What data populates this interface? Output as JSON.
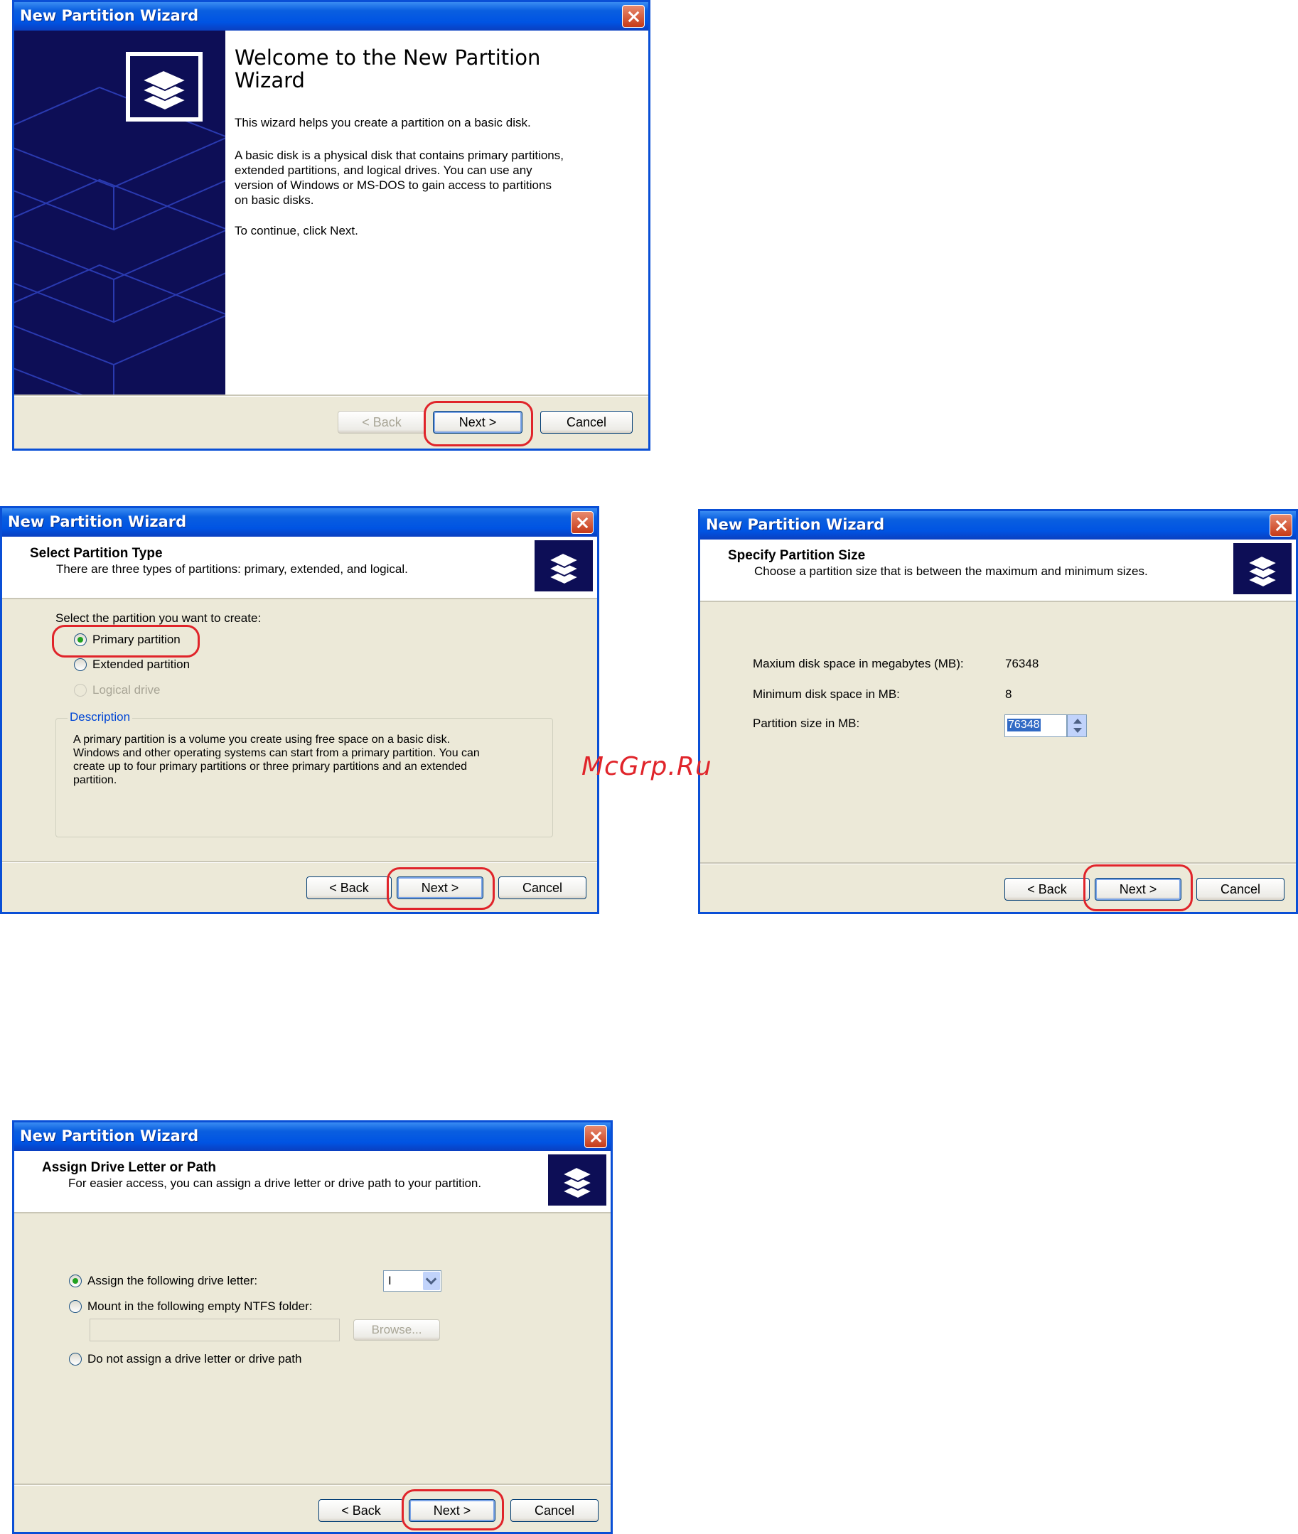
{
  "watermark": "McGrp.Ru",
  "common": {
    "title": "New Partition Wizard",
    "back": "< Back",
    "next": "Next >",
    "cancel": "Cancel"
  },
  "welcome": {
    "heading_line1": "Welcome to the New Partition",
    "heading_line2": "Wizard",
    "p1": "This wizard helps you create a partition on a basic disk.",
    "p2_lines": [
      "A basic disk is a physical disk that contains primary partitions,",
      "extended partitions, and logical drives. You can use any",
      "version of Windows or MS-DOS to gain access to partitions",
      "on basic disks."
    ],
    "p3": "To continue, click Next."
  },
  "select_type": {
    "header_title": "Select Partition Type",
    "header_subtitle": "There are three types of partitions: primary, extended, and logical.",
    "prompt": "Select the partition you want to create:",
    "options": [
      "Primary partition",
      "Extended partition",
      "Logical drive"
    ],
    "description_label": "Description",
    "description_lines": [
      "A primary partition is a volume you create using free space on a basic disk.",
      "Windows and other operating systems can start from a primary partition. You can",
      "create up to four primary partitions or three primary partitions and an extended",
      "partition."
    ]
  },
  "size": {
    "header_title": "Specify Partition Size",
    "header_subtitle": "Choose a partition size that is between the maximum and minimum sizes.",
    "max_label": "Maxium disk space in megabytes (MB):",
    "max_value": "76348",
    "min_label": "Minimum disk space in MB:",
    "min_value": "8",
    "size_label": "Partition size in MB:",
    "size_value": "76348"
  },
  "drive": {
    "header_title": "Assign Drive Letter or Path",
    "header_subtitle": "For easier access, you can assign a drive letter or drive path to your partition.",
    "opt_assign": "Assign the following drive letter:",
    "drive_letter": "I",
    "opt_mount": "Mount in the following empty NTFS folder:",
    "browse": "Browse...",
    "opt_none": "Do not assign a drive letter or drive path"
  }
}
